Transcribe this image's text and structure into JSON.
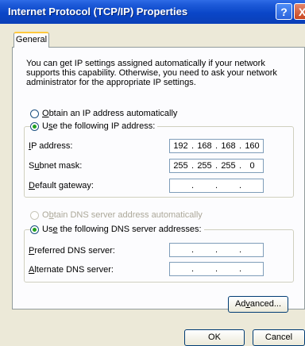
{
  "window": {
    "title": "Internet Protocol (TCP/IP) Properties",
    "help_label": "?",
    "close_label": "X"
  },
  "tabs": {
    "general": "General"
  },
  "description": "You can get IP settings assigned automatically if your network supports this capability. Otherwise, you need to ask your network administrator for the appropriate IP settings.",
  "ip": {
    "auto_pre": "",
    "auto_ul": "O",
    "auto_post": "btain an IP address automatically",
    "manual_pre": "U",
    "manual_ul": "s",
    "manual_post": "e the following IP address:",
    "address_ul": "I",
    "address_post": "P address:",
    "address": [
      "192",
      "168",
      "168",
      "160"
    ],
    "subnet_pre": "S",
    "subnet_ul": "u",
    "subnet_post": "bnet mask:",
    "subnet": [
      "255",
      "255",
      "255",
      "0"
    ],
    "gateway_ul": "D",
    "gateway_post": "efault gateway:",
    "gateway": [
      "",
      "",
      "",
      ""
    ]
  },
  "dns": {
    "auto_pre": "O",
    "auto_ul": "b",
    "auto_post": "tain DNS server address automatically",
    "manual_pre": "Us",
    "manual_ul": "e",
    "manual_post": " the following DNS server addresses:",
    "preferred_ul": "P",
    "preferred_post": "referred DNS server:",
    "preferred": [
      "",
      "",
      "",
      ""
    ],
    "alternate_ul": "A",
    "alternate_post": "lternate DNS server:",
    "alternate": [
      "",
      "",
      "",
      ""
    ]
  },
  "buttons": {
    "advanced_pre": "Ad",
    "advanced_ul": "v",
    "advanced_post": "anced...",
    "ok": "OK",
    "cancel": "Cancel"
  }
}
